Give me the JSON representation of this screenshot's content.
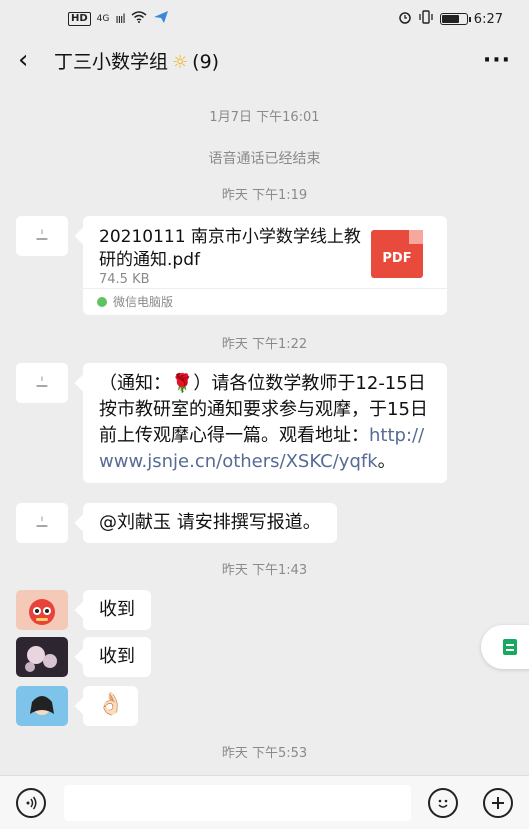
{
  "status_bar": {
    "hd": "HD",
    "net": "4G",
    "signal": "ıııl",
    "time": "6:27",
    "battery_level": 0.75
  },
  "header": {
    "title": "丁三小数学组",
    "emoji": "☼",
    "count": "(9)",
    "back_icon": "chevron-left-icon",
    "more_icon": "more-dots-icon"
  },
  "messages": {
    "ts1": "1月7日 下午16:01",
    "system1": "语音通话已经结束",
    "ts2": "昨天 下午1:19",
    "file": {
      "name": "20210111 南京市小学数学线上教研的通知.pdf",
      "size": "74.5 KB",
      "type_label": "PDF",
      "source": "微信电脑版"
    },
    "ts3": "昨天 下午1:22",
    "notice": {
      "text": "（通知：🌹）请各位数学教师于12-15日按市教研室的通知要求参与观摩，于15日前上传观摩心得一篇。观看地址：",
      "link": "http://www.jsnje.cn/others/XSKC/yqfk",
      "end": "。"
    },
    "mention": "@刘献玉 请安排撰写报道。",
    "ts4": "昨天 下午1:43",
    "reply1": "收到",
    "reply2": "收到",
    "reply3": "👌🏻",
    "ts5": "昨天 下午5:53"
  },
  "input_bar": {
    "voice_icon": "voice-icon",
    "emoji_icon": "emoji-icon",
    "plus_icon": "plus-icon",
    "placeholder": ""
  }
}
